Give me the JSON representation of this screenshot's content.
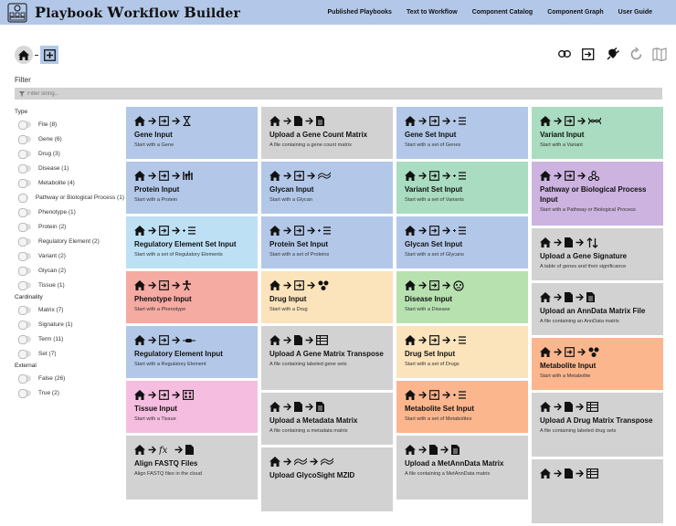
{
  "app": {
    "title_parts": [
      "P",
      "laybook ",
      "W",
      "orkflow ",
      "B",
      "uilder"
    ]
  },
  "nav": [
    "Published Playbooks",
    "Text to Workflow",
    "Component Catalog",
    "Component Graph",
    "User Guide"
  ],
  "filter": {
    "label": "Filter",
    "placeholder": "Filter string..."
  },
  "sidebar": {
    "type_heading": "Type",
    "type_items": [
      "File (8)",
      "Gene (6)",
      "Drug (3)",
      "Disease (1)",
      "Metabolite (4)",
      "Pathway or Biological Process (1)",
      "Phenotype (1)",
      "Protein (2)",
      "Regulatory Element (2)",
      "Variant (2)",
      "Glycan (2)",
      "Tissue (1)"
    ],
    "cardinality_heading": "Cardinality",
    "cardinality_items": [
      "Matrix (7)",
      "Signature (1)",
      "Term (11)",
      "Set (7)"
    ],
    "external_heading": "External",
    "external_items": [
      "False (26)",
      "True (2)"
    ]
  },
  "columns": [
    [
      {
        "title": "Gene Input",
        "desc": "Start with a Gene",
        "color": "#b3c8e8",
        "icons": [
          "home",
          "arrow",
          "input",
          "arrow",
          "hourglass"
        ]
      },
      {
        "title": "Protein Input",
        "desc": "Start with a Protein",
        "color": "#b3c8e8",
        "icons": [
          "home",
          "arrow",
          "input",
          "arrow",
          "bars"
        ]
      },
      {
        "title": "Regulatory Element Set Input",
        "desc": "Start with a set of Regulatory Elements",
        "color": "#bde0f5",
        "icons": [
          "home",
          "arrow",
          "input",
          "arrow",
          "list"
        ]
      },
      {
        "title": "Phenotype Input",
        "desc": "Start with a Phenotype",
        "color": "#f5aaa2",
        "icons": [
          "home",
          "arrow",
          "input",
          "arrow",
          "person"
        ]
      },
      {
        "title": "Regulatory Element Input",
        "desc": "Start with a Regulatory Element",
        "color": "#b3c8e8",
        "icons": [
          "home",
          "arrow",
          "input",
          "arrow",
          "reg"
        ]
      },
      {
        "title": "Tissue Input",
        "desc": "Start with a Tissue",
        "color": "#f5bde0",
        "icons": [
          "home",
          "arrow",
          "input",
          "arrow",
          "tissue"
        ]
      },
      {
        "title": "Align FASTQ Files",
        "desc": "Align FASTQ files in the cloud",
        "color": "#d2d2d2",
        "icons": [
          "home",
          "arrow",
          "fx",
          "arrow",
          "file"
        ]
      }
    ],
    [
      {
        "title": "Upload a Gene Count Matrix",
        "desc": "A file containing a gene count matrix",
        "color": "#d2d2d2",
        "icons": [
          "home",
          "arrow",
          "file",
          "arrow",
          "doc"
        ]
      },
      {
        "title": "Glycan Input",
        "desc": "Start with a Glycan",
        "color": "#b3c8e8",
        "icons": [
          "home",
          "arrow",
          "input",
          "arrow",
          "wave"
        ]
      },
      {
        "title": "Protein Set Input",
        "desc": "Start with a set of Proteins",
        "color": "#b3c8e8",
        "icons": [
          "home",
          "arrow",
          "input",
          "arrow",
          "list"
        ]
      },
      {
        "title": "Drug Input",
        "desc": "Start with a Drug",
        "color": "#fbe3bb",
        "icons": [
          "home",
          "arrow",
          "input",
          "arrow",
          "molecule"
        ]
      },
      {
        "title": "Upload A Gene Matrix Transpose",
        "desc": "A file containing labeled gene sets",
        "color": "#d2d2d2",
        "icons": [
          "home",
          "arrow",
          "file",
          "arrow",
          "table"
        ]
      },
      {
        "title": "Upload a Metadata Matrix",
        "desc": "A file containing a metadata matrix",
        "color": "#d2d2d2",
        "icons": [
          "home",
          "arrow",
          "file",
          "arrow",
          "doc"
        ]
      },
      {
        "title": "Upload GlycoSight MZID",
        "desc": "",
        "color": "#d2d2d2",
        "icons": [
          "home",
          "arrow",
          "wave",
          "arrow",
          "wave"
        ]
      }
    ],
    [
      {
        "title": "Gene Set Input",
        "desc": "Start with a set of Genes",
        "color": "#b3c8e8",
        "icons": [
          "home",
          "arrow",
          "input",
          "arrow",
          "list"
        ]
      },
      {
        "title": "Variant Set Input",
        "desc": "Start with a set of Variants",
        "color": "#a9dcc0",
        "icons": [
          "home",
          "arrow",
          "input",
          "arrow",
          "list"
        ]
      },
      {
        "title": "Glycan Set Input",
        "desc": "Start with a set of Glycans",
        "color": "#b3c8e8",
        "icons": [
          "home",
          "arrow",
          "input",
          "arrow",
          "list"
        ]
      },
      {
        "title": "Disease Input",
        "desc": "Start with a Disease",
        "color": "#b7e2b0",
        "icons": [
          "home",
          "arrow",
          "input",
          "arrow",
          "virus"
        ]
      },
      {
        "title": "Drug Set Input",
        "desc": "Start with a set of Drugs",
        "color": "#fbe3bb",
        "icons": [
          "home",
          "arrow",
          "input",
          "arrow",
          "list"
        ]
      },
      {
        "title": "Metabolite Set Input",
        "desc": "Start with a set of Metabolites",
        "color": "#fbb68e",
        "icons": [
          "home",
          "arrow",
          "input",
          "arrow",
          "list"
        ]
      },
      {
        "title": "Upload a MetAnnData Matrix",
        "desc": "A file containing a MetAnnData matrix",
        "color": "#d2d2d2",
        "icons": [
          "home",
          "arrow",
          "file",
          "arrow",
          "doc"
        ]
      }
    ],
    [
      {
        "title": "Variant Input",
        "desc": "Start with a Variant",
        "color": "#a9dcc0",
        "icons": [
          "home",
          "arrow",
          "input",
          "arrow",
          "dna"
        ]
      },
      {
        "title": "Pathway or Biological Process Input",
        "desc": "Start with a Pathway or Biological Process",
        "color": "#ccb3e0",
        "icons": [
          "home",
          "arrow",
          "input",
          "arrow",
          "pathway"
        ]
      },
      {
        "title": "Upload a Gene Signature",
        "desc": "A table of genes and their significance",
        "color": "#d2d2d2",
        "icons": [
          "home",
          "arrow",
          "file",
          "arrow",
          "updown"
        ]
      },
      {
        "title": "Upload an AnnData Matrix File",
        "desc": "A file containing an AnnData matrix",
        "color": "#d2d2d2",
        "icons": [
          "home",
          "arrow",
          "file",
          "arrow",
          "doc"
        ]
      },
      {
        "title": "Metabolite Input",
        "desc": "Start with a Metabolite",
        "color": "#fbb68e",
        "icons": [
          "home",
          "arrow",
          "input",
          "arrow",
          "molecule"
        ]
      },
      {
        "title": "Upload A Drug Matrix Transpose",
        "desc": "A file containing labeled drug sets",
        "color": "#d2d2d2",
        "icons": [
          "home",
          "arrow",
          "file",
          "arrow",
          "table"
        ]
      },
      {
        "title": "",
        "desc": "",
        "color": "#d2d2d2",
        "icons": [
          "home",
          "arrow",
          "file",
          "arrow",
          "table"
        ]
      }
    ]
  ]
}
